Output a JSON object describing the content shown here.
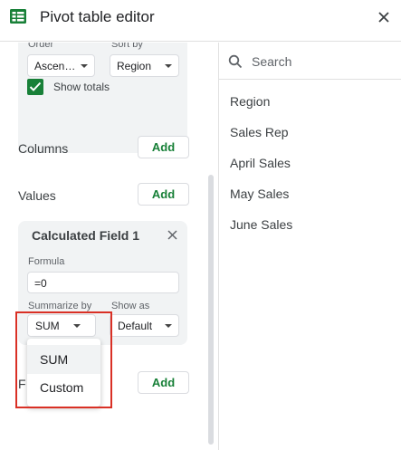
{
  "header": {
    "title": "Pivot table editor"
  },
  "rows_card": {
    "order_label": "Order",
    "order_value": "Ascen…",
    "sortby_label": "Sort by",
    "sortby_value": "Region",
    "show_totals_label": "Show totals",
    "show_totals_checked": true
  },
  "columns": {
    "label": "Columns",
    "add_label": "Add"
  },
  "values": {
    "label": "Values",
    "add_label": "Add"
  },
  "calc_field": {
    "title": "Calculated Field 1",
    "formula_label": "Formula",
    "formula_value": "=0",
    "summarize_label": "Summarize by",
    "summarize_value": "SUM",
    "showas_label": "Show as",
    "showas_value": "Default"
  },
  "filters": {
    "label_partial": "F",
    "add_label": "Add"
  },
  "summarize_dropdown": {
    "options": [
      "SUM",
      "Custom"
    ],
    "selected": "SUM"
  },
  "search": {
    "placeholder": "Search"
  },
  "field_list": [
    "Region",
    "Sales Rep",
    "April Sales",
    "May Sales",
    "June Sales"
  ],
  "colors": {
    "accent_green": "#188038",
    "highlight_red": "#d93025",
    "card_bg": "#f1f3f4"
  }
}
